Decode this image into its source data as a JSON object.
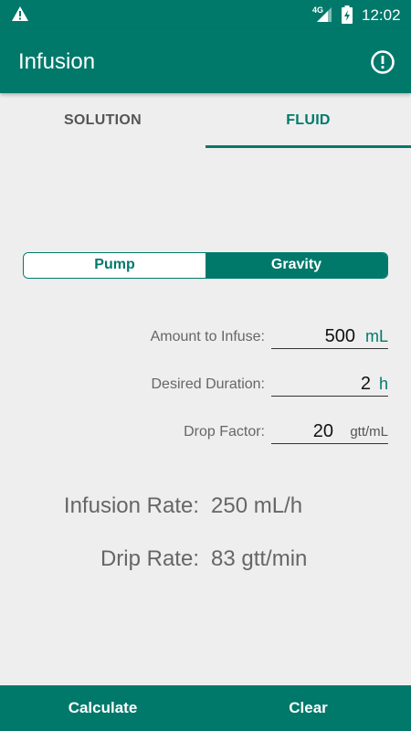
{
  "status_bar": {
    "network": "4G",
    "time": "12:02"
  },
  "app_bar": {
    "title": "Infusion"
  },
  "tabs": [
    {
      "label": "SOLUTION",
      "selected": false
    },
    {
      "label": "FLUID",
      "selected": true
    }
  ],
  "mode_toggle": {
    "options": [
      "Pump",
      "Gravity"
    ],
    "selected": "Gravity"
  },
  "inputs": {
    "amount": {
      "label": "Amount to Infuse:",
      "value": "500",
      "unit": "mL"
    },
    "duration": {
      "label": "Desired Duration:",
      "value": "2",
      "unit": "h"
    },
    "drop_factor": {
      "label": "Drop Factor:",
      "value": "20",
      "unit": "gtt/mL"
    }
  },
  "results": {
    "infusion_rate": {
      "label": "Infusion Rate:",
      "value": "250 mL/h"
    },
    "drip_rate": {
      "label": "Drip Rate:",
      "value": "83 gtt/min"
    }
  },
  "actions": {
    "calculate": "Calculate",
    "clear": "Clear"
  },
  "colors": {
    "primary": "#00796b",
    "background": "#eeeeee"
  },
  "icons": [
    "warning-icon",
    "signal-icon",
    "battery-icon",
    "info-icon"
  ]
}
